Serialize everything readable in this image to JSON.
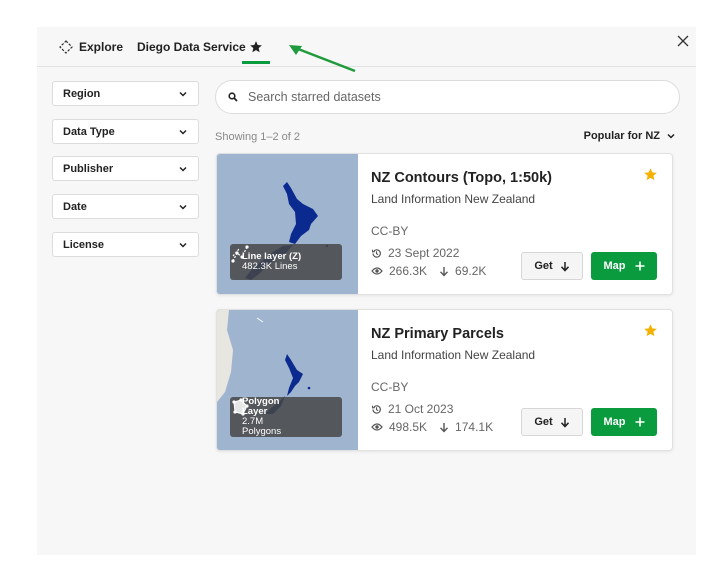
{
  "header": {
    "tabs": [
      {
        "label": "Explore",
        "icon": "explore-diamond-icon"
      },
      {
        "label": "Diego Data Service"
      },
      {
        "label": "",
        "icon": "star-icon",
        "active": true
      }
    ],
    "close_icon": "close-icon"
  },
  "filters": [
    "Region",
    "Data Type",
    "Publisher",
    "Date",
    "License"
  ],
  "search": {
    "placeholder": "Search starred datasets",
    "value": ""
  },
  "results": {
    "showing": "Showing 1–2 of 2",
    "sort_label": "Popular for NZ"
  },
  "datasets": [
    {
      "title": "NZ Contours (Topo, 1:50k)",
      "publisher": "Land Information New Zealand",
      "license": "CC-BY",
      "date": "23 Sept 2022",
      "views": "266.3K",
      "downloads": "69.2K",
      "layer_type": "Line layer (Z)",
      "feature_count": "482.3K Lines",
      "starred": true
    },
    {
      "title": "NZ Primary Parcels",
      "publisher": "Land Information New Zealand",
      "license": "CC-BY",
      "date": "21 Oct 2023",
      "views": "498.5K",
      "downloads": "174.1K",
      "layer_type": "Polygon Layer",
      "feature_count": "2.7M Polygons",
      "starred": true
    }
  ],
  "buttons": {
    "get": "Get",
    "map": "Map"
  },
  "colors": {
    "accent": "#0a9b3e",
    "star": "#f5b100",
    "map_water": "#9fb5cf",
    "map_land": "#0b2a8f"
  }
}
